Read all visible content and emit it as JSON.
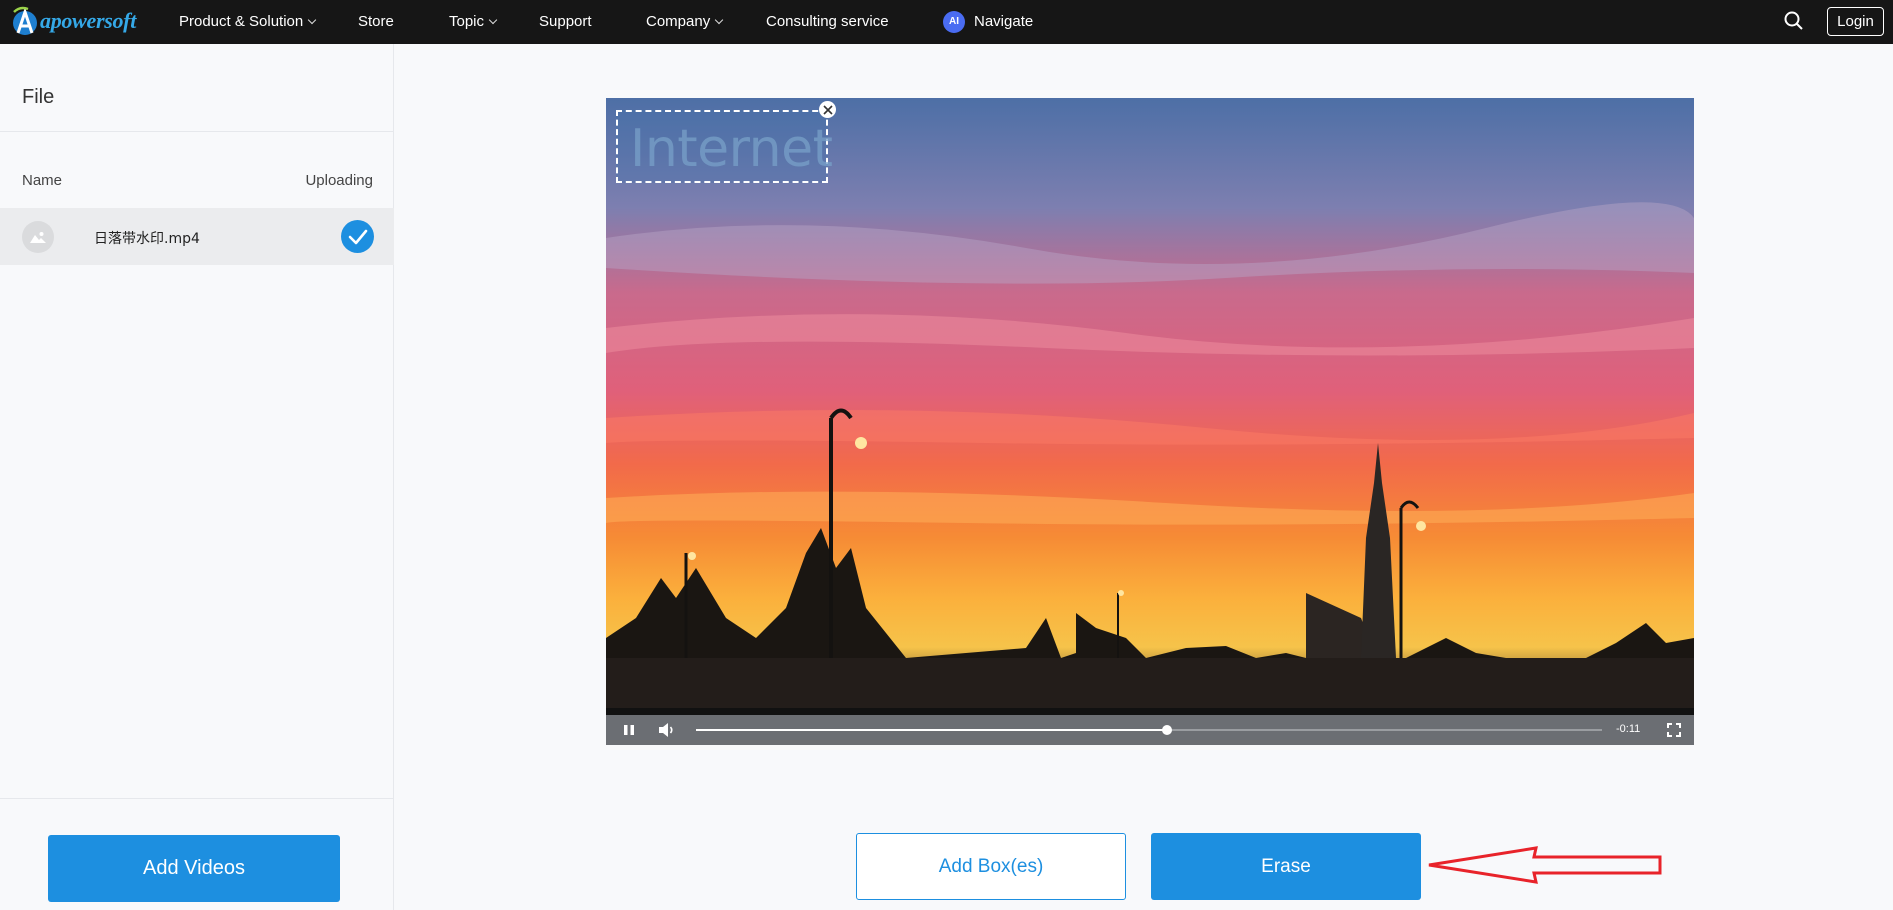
{
  "nav": {
    "brand": "apowersoft",
    "items": [
      {
        "label": "Product & Solution",
        "has_dropdown": true
      },
      {
        "label": "Store",
        "has_dropdown": false
      },
      {
        "label": "Topic",
        "has_dropdown": true
      },
      {
        "label": "Support",
        "has_dropdown": false
      },
      {
        "label": "Company",
        "has_dropdown": true
      },
      {
        "label": "Consulting service",
        "has_dropdown": false
      }
    ],
    "ai_badge": "AI",
    "navigate_label": "Navigate",
    "search_icon": "search-icon",
    "login_label": "Login"
  },
  "sidebar": {
    "title": "File",
    "columns": {
      "name": "Name",
      "status": "Uploading"
    },
    "files": [
      {
        "name": "日落带水印.mp4",
        "thumb_icon": "image-icon",
        "status_icon": "check-circle-icon"
      }
    ],
    "add_button": "Add Videos"
  },
  "video": {
    "watermark_text": "Internet",
    "remaining_time": "-0:11",
    "progress_fraction": 0.52,
    "controls": [
      "pause-icon",
      "volume-icon",
      "fullscreen-icon"
    ]
  },
  "actions": {
    "add_box_label": "Add Box(es)",
    "erase_label": "Erase"
  },
  "colors": {
    "accent": "#1d8fe0",
    "topbar": "#161616",
    "brand": "#35a9e8",
    "annotation": "#e8232a"
  }
}
